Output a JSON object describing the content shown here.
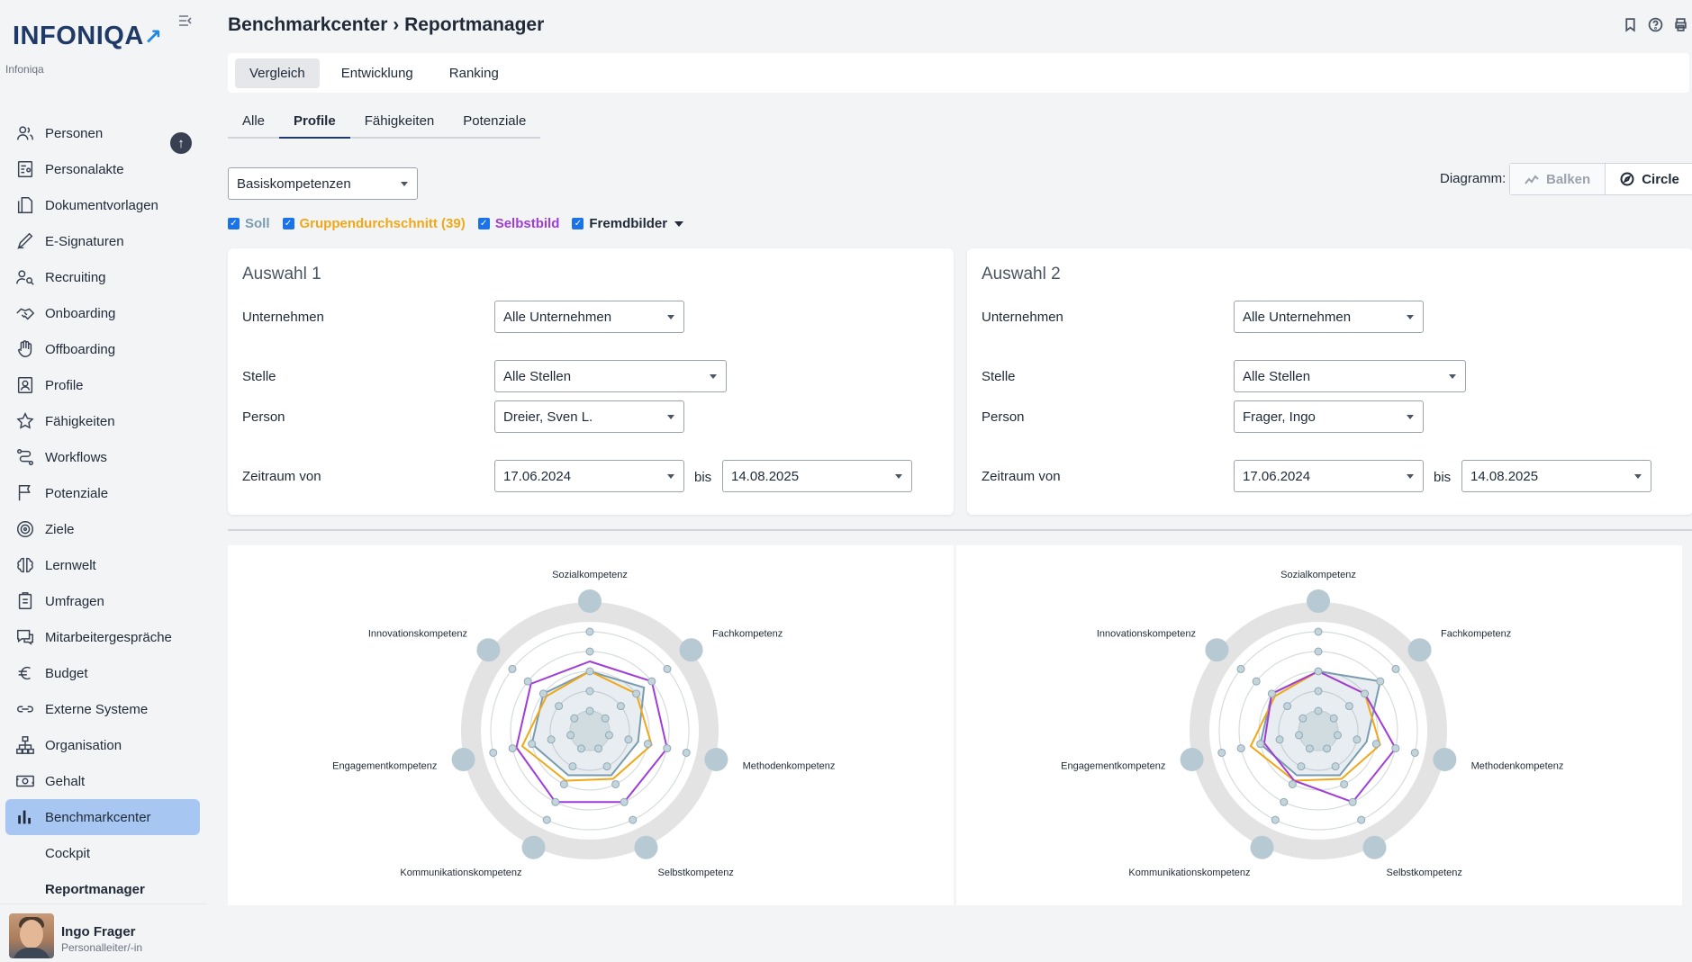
{
  "app": {
    "logo_text": "INFONIQA",
    "logo_arrow": "↗",
    "tenant": "Infoniqa"
  },
  "sidebar": {
    "items": [
      {
        "label": "Personen",
        "icon": "persons-icon"
      },
      {
        "label": "Personalakte",
        "icon": "personnel-file-icon"
      },
      {
        "label": "Dokumentvorlagen",
        "icon": "documents-icon"
      },
      {
        "label": "E-Signaturen",
        "icon": "pen-icon"
      },
      {
        "label": "Recruiting",
        "icon": "recruiting-icon"
      },
      {
        "label": "Onboarding",
        "icon": "handshake-icon"
      },
      {
        "label": "Offboarding",
        "icon": "hand-icon"
      },
      {
        "label": "Profile",
        "icon": "profile-icon"
      },
      {
        "label": "Fähigkeiten",
        "icon": "star-icon"
      },
      {
        "label": "Workflows",
        "icon": "workflow-icon"
      },
      {
        "label": "Potenziale",
        "icon": "flag-icon"
      },
      {
        "label": "Ziele",
        "icon": "target-icon"
      },
      {
        "label": "Lernwelt",
        "icon": "brain-icon"
      },
      {
        "label": "Umfragen",
        "icon": "clipboard-icon"
      },
      {
        "label": "Mitarbeitergespräche",
        "icon": "chat-icon"
      },
      {
        "label": "Budget",
        "icon": "euro-icon"
      },
      {
        "label": "Externe Systeme",
        "icon": "link-icon"
      },
      {
        "label": "Organisation",
        "icon": "org-icon"
      },
      {
        "label": "Gehalt",
        "icon": "money-icon"
      },
      {
        "label": "Benchmarkcenter",
        "icon": "bar-chart-icon"
      }
    ],
    "subitems": [
      {
        "label": "Cockpit"
      },
      {
        "label": "Reportmanager"
      }
    ]
  },
  "user": {
    "name": "Ingo Frager",
    "role": "Personalleiter/-in"
  },
  "header": {
    "title": "Benchmarkcenter › Reportmanager"
  },
  "tabs": [
    {
      "label": "Vergleich"
    },
    {
      "label": "Entwicklung"
    },
    {
      "label": "Ranking"
    }
  ],
  "subtabs": [
    {
      "label": "Alle"
    },
    {
      "label": "Profile"
    },
    {
      "label": "Fähigkeiten"
    },
    {
      "label": "Potenziale"
    }
  ],
  "filters": {
    "category": "Basiskompetenzen",
    "checks": [
      {
        "label": "Soll",
        "color": "#7a9cb0"
      },
      {
        "label": "Gruppendurchschnitt (39)",
        "color": "#f0a818"
      },
      {
        "label": "Selbstbild",
        "color": "#a03cd8"
      },
      {
        "label": "Fremdbilder",
        "color": "#1f2937"
      }
    ],
    "diagram_label": "Diagramm:",
    "diagram_options": [
      {
        "label": "Balken"
      },
      {
        "label": "Circle"
      }
    ]
  },
  "selections": [
    {
      "title": "Auswahl 1",
      "labels": {
        "company": "Unternehmen",
        "position": "Stelle",
        "person": "Person",
        "period": "Zeitraum von",
        "to": "bis"
      },
      "company": "Alle Unternehmen",
      "position": "Alle Stellen",
      "person": "Dreier, Sven L.",
      "from": "17.06.2024",
      "until": "14.08.2025"
    },
    {
      "title": "Auswahl 2",
      "labels": {
        "company": "Unternehmen",
        "position": "Stelle",
        "person": "Person",
        "period": "Zeitraum von",
        "to": "bis"
      },
      "company": "Alle Unternehmen",
      "position": "Alle Stellen",
      "person": "Frager, Ingo",
      "from": "17.06.2024",
      "until": "14.08.2025"
    }
  ],
  "chart_data": [
    {
      "type": "radar",
      "axes": [
        "Sozialkompetenz",
        "Fachkompetenz",
        "Methodenkompetenz",
        "Selbstkompetenz",
        "Kommunikationskompetenz",
        "Engagementkompetenz",
        "Innovationskompetenz"
      ],
      "rlim": [
        0,
        5
      ],
      "series": [
        {
          "name": "Soll",
          "color": "#7a9cb0",
          "values": [
            3,
            3.5,
            2.5,
            2.5,
            2.5,
            3,
            3
          ]
        },
        {
          "name": "Gruppendurchschnitt (39)",
          "color": "#f0a818",
          "values": [
            3,
            3,
            3.2,
            2.7,
            2.8,
            3.5,
            2.8
          ]
        },
        {
          "name": "Selbstbild",
          "color": "#a03cd8",
          "values": [
            3.5,
            4,
            4,
            4,
            4,
            3.8,
            3.8
          ]
        }
      ]
    },
    {
      "type": "radar",
      "axes": [
        "Sozialkompetenz",
        "Fachkompetenz",
        "Methodenkompetenz",
        "Selbstkompetenz",
        "Kommunikationskompetenz",
        "Engagementkompetenz",
        "Innovationskompetenz"
      ],
      "rlim": [
        0,
        5
      ],
      "series": [
        {
          "name": "Soll",
          "color": "#7a9cb0",
          "values": [
            3,
            4,
            2.5,
            2.5,
            2.5,
            3,
            3
          ]
        },
        {
          "name": "Gruppendurchschnitt (39)",
          "color": "#f0a818",
          "values": [
            3,
            3,
            3.2,
            2.7,
            2.8,
            3.5,
            2.8
          ]
        },
        {
          "name": "Selbstbild",
          "color": "#a03cd8",
          "values": [
            3,
            3,
            4,
            4,
            2.8,
            2.8,
            3
          ]
        }
      ]
    }
  ]
}
